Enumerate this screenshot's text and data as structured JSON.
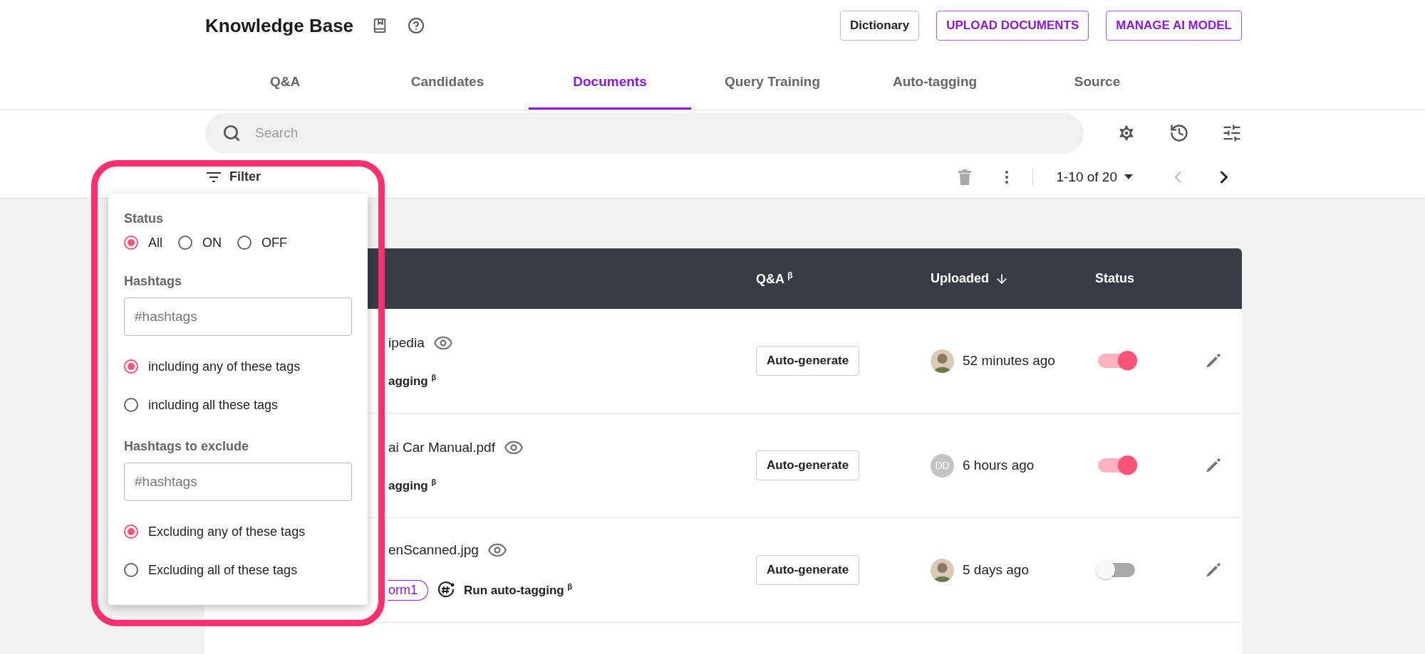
{
  "header": {
    "title": "Knowledge Base",
    "buttons": [
      {
        "label": "Dictionary",
        "kind": "plain"
      },
      {
        "label": "UPLOAD DOCUMENTS",
        "kind": "accent"
      },
      {
        "label": "MANAGE AI MODEL",
        "kind": "accent"
      }
    ]
  },
  "tabs": [
    {
      "label": "Q&A",
      "selected": false
    },
    {
      "label": "Candidates",
      "selected": false
    },
    {
      "label": "Documents",
      "selected": true
    },
    {
      "label": "Query Training",
      "selected": false
    },
    {
      "label": "Auto-tagging",
      "selected": false
    },
    {
      "label": "Source",
      "selected": false
    }
  ],
  "search": {
    "placeholder": "Search"
  },
  "toolbar": {
    "filter": "Filter",
    "pagination": "1-10 of 20"
  },
  "filter_panel": {
    "status_label": "Status",
    "status_options": [
      {
        "label": "All",
        "selected": true
      },
      {
        "label": "ON",
        "selected": false
      },
      {
        "label": "OFF",
        "selected": false
      }
    ],
    "hashtags_label": "Hashtags",
    "hashtags_placeholder": "#hashtags",
    "hashtags_modes": [
      {
        "label": "including any of these tags",
        "selected": true
      },
      {
        "label": "including all these tags",
        "selected": false
      }
    ],
    "exclude_label": "Hashtags to exclude",
    "exclude_placeholder": "#hashtags",
    "exclude_modes": [
      {
        "label": "Excluding any of these tags",
        "selected": true
      },
      {
        "label": "Excluding all of these tags",
        "selected": false
      }
    ]
  },
  "table": {
    "columns": [
      {
        "label": "Q&A $^{β}$"
      },
      {
        "label": "Uploaded",
        "sorted_descending": true
      },
      {
        "label": "Status"
      }
    ],
    "rows": [
      {
        "name": "ipedia",
        "action": "agging $^{β}$",
        "qa_button": "Auto-generate",
        "avatar": {
          "kind": "photo"
        },
        "uploaded": "52 minutes ago",
        "on": true
      },
      {
        "name": "ai Car Manual.pdf",
        "action": "agging $^{β}$",
        "qa_button": "Auto-generate",
        "avatar": {
          "kind": "initials",
          "text": "DD"
        },
        "uploaded": "6 hours ago",
        "on": true
      },
      {
        "name": "enScanned.jpg",
        "tag": "orm1",
        "run_action": "Run auto-tagging $^{β}$",
        "qa_button": "Auto-generate",
        "avatar": {
          "kind": "photo"
        },
        "uploaded": "5 days ago",
        "on": false
      }
    ]
  }
}
